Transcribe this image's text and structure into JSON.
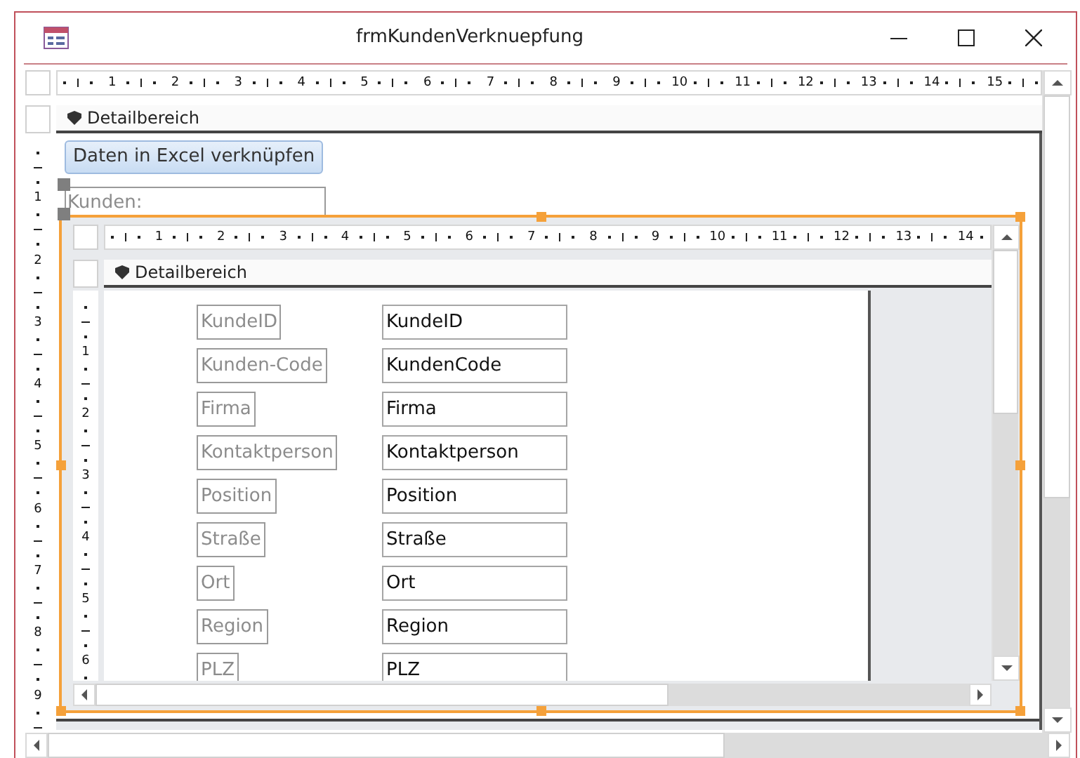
{
  "window": {
    "title": "frmKundenVerknuepfung"
  },
  "ruler": {
    "marks": [
      "1",
      "2",
      "3",
      "4",
      "5",
      "6",
      "7",
      "8",
      "9",
      "10",
      "11",
      "12",
      "13",
      "14",
      "15"
    ]
  },
  "vertical_ruler": {
    "marks": [
      "1",
      "2",
      "3",
      "4",
      "5",
      "6",
      "7",
      "8",
      "9"
    ]
  },
  "section": {
    "title": "Detailbereich"
  },
  "button": {
    "label": "Daten in Excel verknüpfen"
  },
  "label": {
    "text": "Kunden:"
  },
  "subform": {
    "selected": true,
    "ruler": {
      "marks": [
        "1",
        "2",
        "3",
        "4",
        "5",
        "6",
        "7",
        "8",
        "9",
        "10",
        "11",
        "12",
        "13",
        "14"
      ]
    },
    "vertical_ruler": {
      "marks": [
        "1",
        "2",
        "3",
        "4",
        "5",
        "6"
      ]
    },
    "section": {
      "title": "Detailbereich"
    },
    "fields": [
      {
        "label": "KundeID",
        "control": "KundeID"
      },
      {
        "label": "Kunden-Code",
        "control": "KundenCode"
      },
      {
        "label": "Firma",
        "control": "Firma"
      },
      {
        "label": "Kontaktperson",
        "control": "Kontaktperson"
      },
      {
        "label": "Position",
        "control": "Position"
      },
      {
        "label": "Straße",
        "control": "Straße"
      },
      {
        "label": "Ort",
        "control": "Ort"
      },
      {
        "label": "Region",
        "control": "Region"
      },
      {
        "label": "PLZ",
        "control": "PLZ"
      }
    ]
  }
}
